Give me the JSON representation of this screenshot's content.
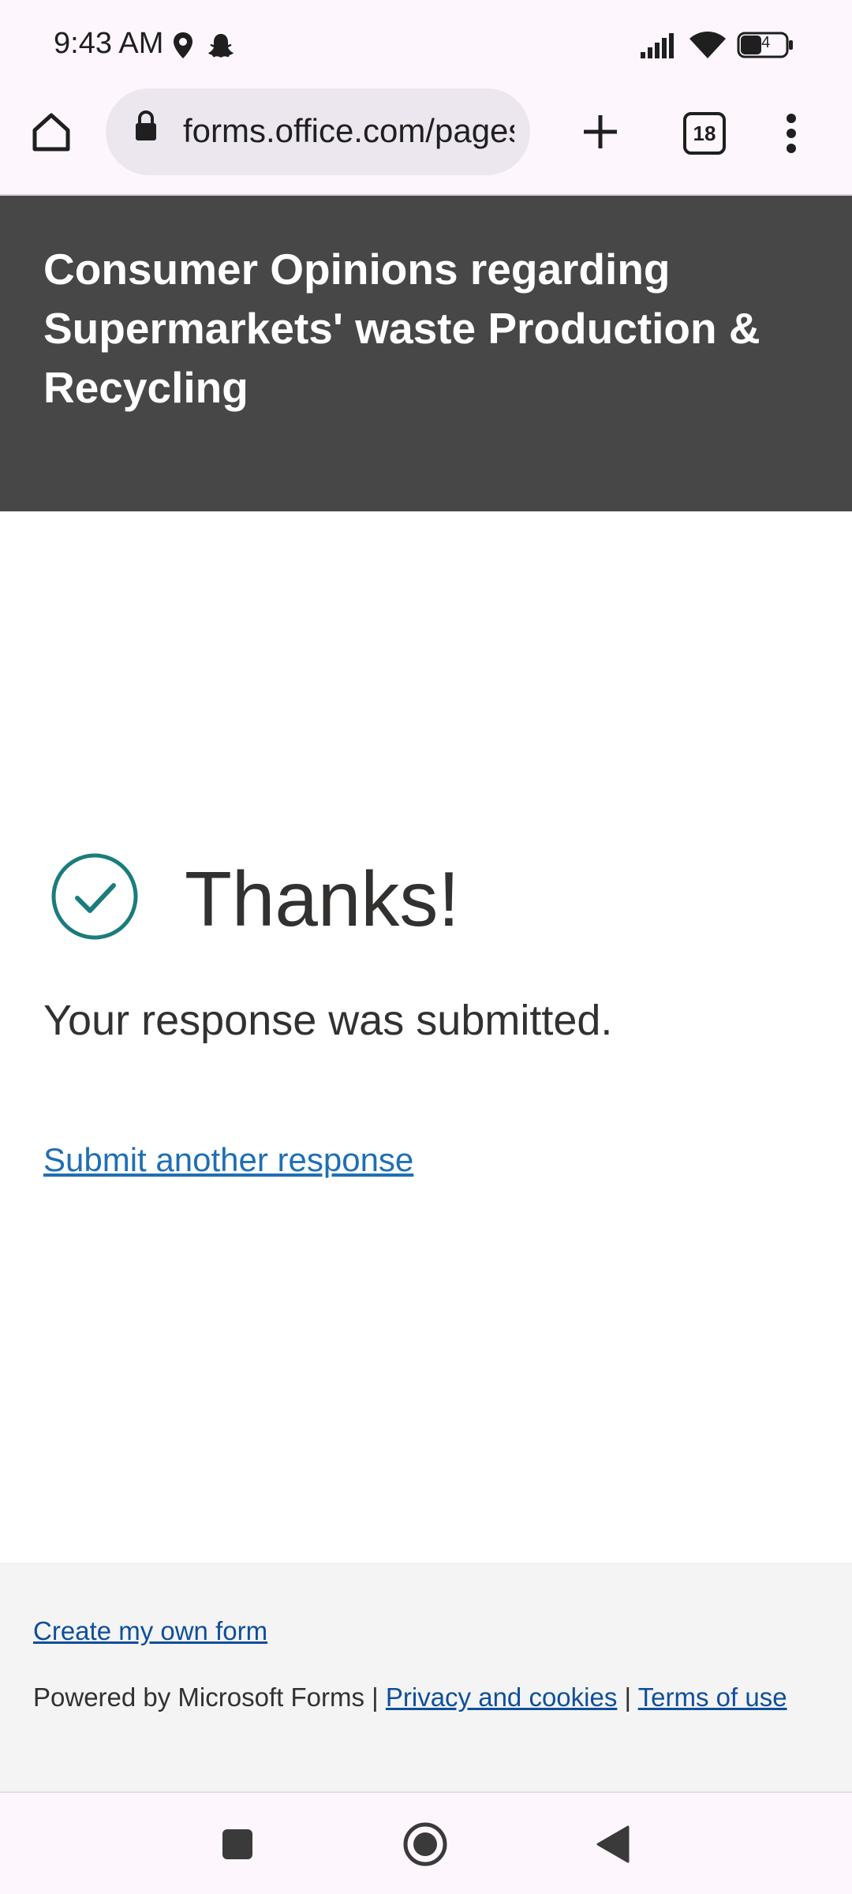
{
  "status": {
    "time": "9:43 AM",
    "battery": "44"
  },
  "browser": {
    "url": "forms.office.com/pages/responsepage.aspx",
    "tab_count": "18"
  },
  "form": {
    "title": "Consumer Opinions regarding Supermarkets' waste Production & Recycling",
    "thanks": "Thanks!",
    "submitted_message": "Your response was submitted.",
    "submit_another": "Submit another response"
  },
  "footer": {
    "create_form": "Create my own form",
    "powered_by": "Powered by Microsoft Forms |",
    "separator": "|",
    "privacy": "Privacy and cookies",
    "terms": "Terms of use"
  },
  "colors": {
    "header_bg": "#464746",
    "check_accent": "#1b7c7c",
    "link": "#1f6fb5",
    "footer_link": "#0f4f9a"
  }
}
